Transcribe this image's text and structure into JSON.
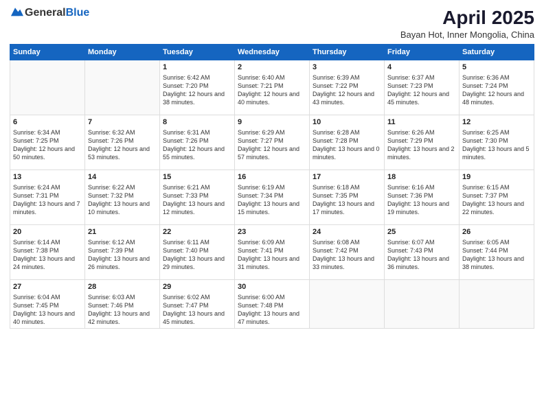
{
  "logo": {
    "general": "General",
    "blue": "Blue"
  },
  "title": "April 2025",
  "subtitle": "Bayan Hot, Inner Mongolia, China",
  "weekdays": [
    "Sunday",
    "Monday",
    "Tuesday",
    "Wednesday",
    "Thursday",
    "Friday",
    "Saturday"
  ],
  "weeks": [
    [
      {
        "day": "",
        "info": ""
      },
      {
        "day": "",
        "info": ""
      },
      {
        "day": "1",
        "info": "Sunrise: 6:42 AM\nSunset: 7:20 PM\nDaylight: 12 hours and 38 minutes."
      },
      {
        "day": "2",
        "info": "Sunrise: 6:40 AM\nSunset: 7:21 PM\nDaylight: 12 hours and 40 minutes."
      },
      {
        "day": "3",
        "info": "Sunrise: 6:39 AM\nSunset: 7:22 PM\nDaylight: 12 hours and 43 minutes."
      },
      {
        "day": "4",
        "info": "Sunrise: 6:37 AM\nSunset: 7:23 PM\nDaylight: 12 hours and 45 minutes."
      },
      {
        "day": "5",
        "info": "Sunrise: 6:36 AM\nSunset: 7:24 PM\nDaylight: 12 hours and 48 minutes."
      }
    ],
    [
      {
        "day": "6",
        "info": "Sunrise: 6:34 AM\nSunset: 7:25 PM\nDaylight: 12 hours and 50 minutes."
      },
      {
        "day": "7",
        "info": "Sunrise: 6:32 AM\nSunset: 7:26 PM\nDaylight: 12 hours and 53 minutes."
      },
      {
        "day": "8",
        "info": "Sunrise: 6:31 AM\nSunset: 7:26 PM\nDaylight: 12 hours and 55 minutes."
      },
      {
        "day": "9",
        "info": "Sunrise: 6:29 AM\nSunset: 7:27 PM\nDaylight: 12 hours and 57 minutes."
      },
      {
        "day": "10",
        "info": "Sunrise: 6:28 AM\nSunset: 7:28 PM\nDaylight: 13 hours and 0 minutes."
      },
      {
        "day": "11",
        "info": "Sunrise: 6:26 AM\nSunset: 7:29 PM\nDaylight: 13 hours and 2 minutes."
      },
      {
        "day": "12",
        "info": "Sunrise: 6:25 AM\nSunset: 7:30 PM\nDaylight: 13 hours and 5 minutes."
      }
    ],
    [
      {
        "day": "13",
        "info": "Sunrise: 6:24 AM\nSunset: 7:31 PM\nDaylight: 13 hours and 7 minutes."
      },
      {
        "day": "14",
        "info": "Sunrise: 6:22 AM\nSunset: 7:32 PM\nDaylight: 13 hours and 10 minutes."
      },
      {
        "day": "15",
        "info": "Sunrise: 6:21 AM\nSunset: 7:33 PM\nDaylight: 13 hours and 12 minutes."
      },
      {
        "day": "16",
        "info": "Sunrise: 6:19 AM\nSunset: 7:34 PM\nDaylight: 13 hours and 15 minutes."
      },
      {
        "day": "17",
        "info": "Sunrise: 6:18 AM\nSunset: 7:35 PM\nDaylight: 13 hours and 17 minutes."
      },
      {
        "day": "18",
        "info": "Sunrise: 6:16 AM\nSunset: 7:36 PM\nDaylight: 13 hours and 19 minutes."
      },
      {
        "day": "19",
        "info": "Sunrise: 6:15 AM\nSunset: 7:37 PM\nDaylight: 13 hours and 22 minutes."
      }
    ],
    [
      {
        "day": "20",
        "info": "Sunrise: 6:14 AM\nSunset: 7:38 PM\nDaylight: 13 hours and 24 minutes."
      },
      {
        "day": "21",
        "info": "Sunrise: 6:12 AM\nSunset: 7:39 PM\nDaylight: 13 hours and 26 minutes."
      },
      {
        "day": "22",
        "info": "Sunrise: 6:11 AM\nSunset: 7:40 PM\nDaylight: 13 hours and 29 minutes."
      },
      {
        "day": "23",
        "info": "Sunrise: 6:09 AM\nSunset: 7:41 PM\nDaylight: 13 hours and 31 minutes."
      },
      {
        "day": "24",
        "info": "Sunrise: 6:08 AM\nSunset: 7:42 PM\nDaylight: 13 hours and 33 minutes."
      },
      {
        "day": "25",
        "info": "Sunrise: 6:07 AM\nSunset: 7:43 PM\nDaylight: 13 hours and 36 minutes."
      },
      {
        "day": "26",
        "info": "Sunrise: 6:05 AM\nSunset: 7:44 PM\nDaylight: 13 hours and 38 minutes."
      }
    ],
    [
      {
        "day": "27",
        "info": "Sunrise: 6:04 AM\nSunset: 7:45 PM\nDaylight: 13 hours and 40 minutes."
      },
      {
        "day": "28",
        "info": "Sunrise: 6:03 AM\nSunset: 7:46 PM\nDaylight: 13 hours and 42 minutes."
      },
      {
        "day": "29",
        "info": "Sunrise: 6:02 AM\nSunset: 7:47 PM\nDaylight: 13 hours and 45 minutes."
      },
      {
        "day": "30",
        "info": "Sunrise: 6:00 AM\nSunset: 7:48 PM\nDaylight: 13 hours and 47 minutes."
      },
      {
        "day": "",
        "info": ""
      },
      {
        "day": "",
        "info": ""
      },
      {
        "day": "",
        "info": ""
      }
    ]
  ]
}
